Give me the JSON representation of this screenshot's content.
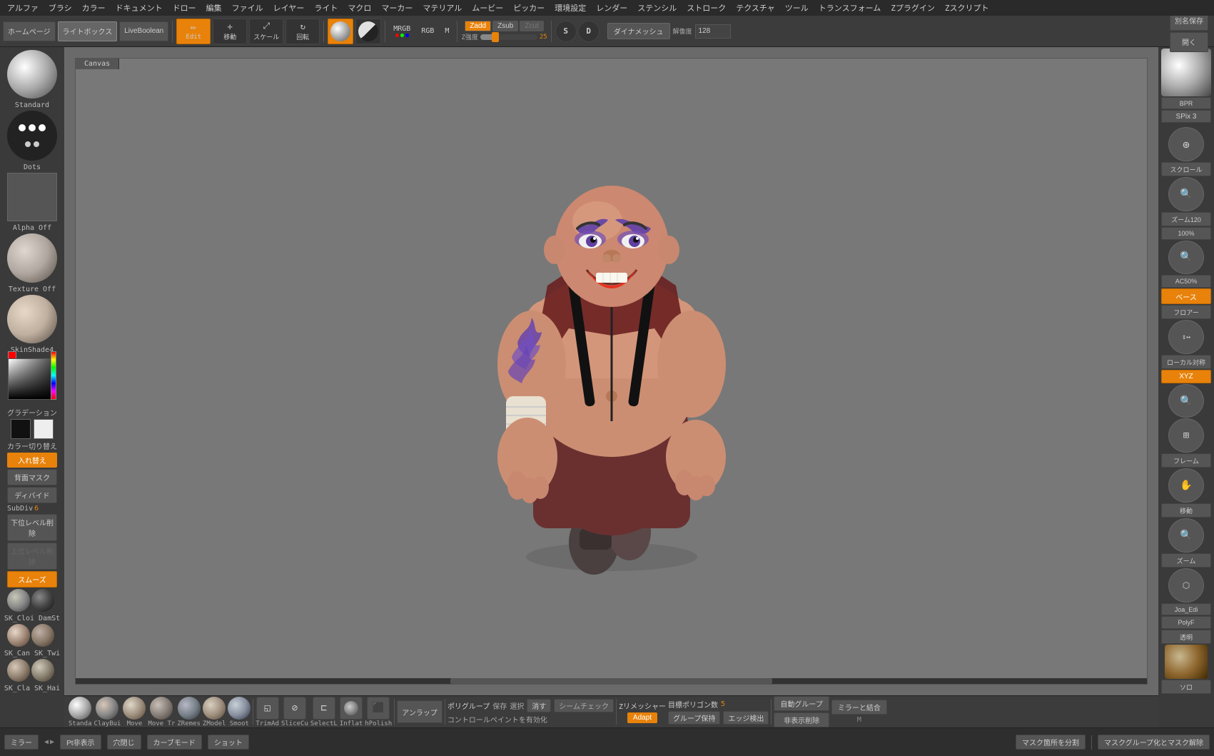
{
  "menu": {
    "items": [
      "アルファ",
      "ブラシ",
      "カラー",
      "ドキュメント",
      "ドロー",
      "編集",
      "ファイル",
      "レイヤー",
      "ライト",
      "マクロ",
      "マーカー",
      "マテリアル",
      "ムービー",
      "ピッカー",
      "環境設定",
      "レンダー",
      "ステンシル",
      "ストローク",
      "テクスチャ",
      "ツール",
      "トランスフォーム",
      "Zプラグイン",
      "Zスクリプト"
    ]
  },
  "toolbar": {
    "homepage": "ホームページ",
    "lightbox": "ライトボックス",
    "live_boolean": "LiveBoolean",
    "edit_btn": "Edit",
    "move_btn": "移動",
    "scale_btn": "スケール",
    "rotate_btn": "回転",
    "mrgb": "MRGB",
    "rgb": "RGB",
    "m": "M",
    "zadd": "Zadd",
    "zsub": "Zsub",
    "zcut": "Zcut",
    "z_intensity_label": "Z強度",
    "z_intensity_value": "25",
    "dynameshs": "ダイナメッシュ",
    "resolution_label": "解像度",
    "resolution_value": "128",
    "save_as": "別名保存",
    "open": "開く"
  },
  "left_panel": {
    "standard_label": "Standard",
    "dots_label": "Dots",
    "alpha_label": "Alpha Off",
    "texture_label": "Texture Off",
    "material_label": "SkinShade4",
    "gradient_label": "グラデーション",
    "color_switch_label": "カラー切り替え",
    "swap_btn": "入れ替え",
    "back_mask": "背面マスク",
    "divide_label": "ディバイド",
    "subdiv_label": "SubDiv",
    "subdiv_value": "6",
    "delete_lower": "下位レベル削除",
    "delete_upper": "上位レベル削除",
    "smooth_btn": "スムーズ",
    "brush1": "SK_Cloi DamSt",
    "brush2": "SK_Can SK_Twi",
    "brush3": "SK_Cla SK_Hai"
  },
  "right_panel": {
    "bpr": "BPR",
    "spix3": "SPix 3",
    "scroll": "スクロール",
    "zoom_label": "ズーム120",
    "zoom2": "100%",
    "ac50": "AC50%",
    "base_btn": "ベース",
    "floor_btn": "フロアー",
    "local_sym": "ローカル対称",
    "xyz": "XYZ",
    "btn1": "移動",
    "btn2": "ズーム",
    "btn3": "フレーム",
    "btn4": "移動",
    "btn5": "ズーム",
    "joa_edit": "Joa_Edi",
    "polyf": "PolyF",
    "transparent": "透明",
    "solo": "ソロ"
  },
  "bottom_toolbar": {
    "brushes": [
      {
        "label": "Standa",
        "type": "sphere"
      },
      {
        "label": "ClayBui",
        "type": "sphere"
      },
      {
        "label": "Move",
        "type": "sphere"
      },
      {
        "label": "Move Tr",
        "type": "sphere"
      },
      {
        "label": "ZRemes",
        "type": "sphere"
      },
      {
        "label": "ZModel",
        "type": "sphere"
      },
      {
        "label": "Smoot",
        "type": "sphere"
      }
    ],
    "tools": [
      {
        "label": "TrimAd"
      },
      {
        "label": "SliceCu"
      },
      {
        "label": "SelectL"
      },
      {
        "label": "Inflat"
      },
      {
        "label": "hPolish"
      }
    ],
    "unwrap_btn": "アンラップ",
    "poly_group": "ポリグループ",
    "save_label": "保存",
    "select_label": "選択",
    "delete_btn": "消す",
    "seam_check": "シームチェック",
    "enable_control_paint": "コントロールペイントを有効化",
    "z_remesher": "Zリメッシャー",
    "adapt_btn": "Adapt",
    "target_poly": "目標ポリゴン数",
    "target_value": "5",
    "group_keep": "グループ保持",
    "edge_detect": "エッジ検出",
    "auto_group": "自動グループ",
    "hide_delete": "非表示削除",
    "mirror_merge": "ミラーと結合",
    "shortcut": "M"
  },
  "status_bar": {
    "mirror_btn": "ミラー",
    "pt_display": "Pt非表示",
    "fill_hole": "穴閉じ",
    "curve_mode": "カーブモード",
    "shot_btn": "ショット",
    "mask_area": "マスク箇所を分割",
    "mask_group": "マスクグループ化とマスク解除"
  },
  "canvas": {
    "tab": "Canvas"
  },
  "colors": {
    "orange": "#e8820a",
    "bg_dark": "#2a2a2a",
    "bg_mid": "#3a3a3a",
    "bg_light": "#555555",
    "text": "#cccccc"
  }
}
